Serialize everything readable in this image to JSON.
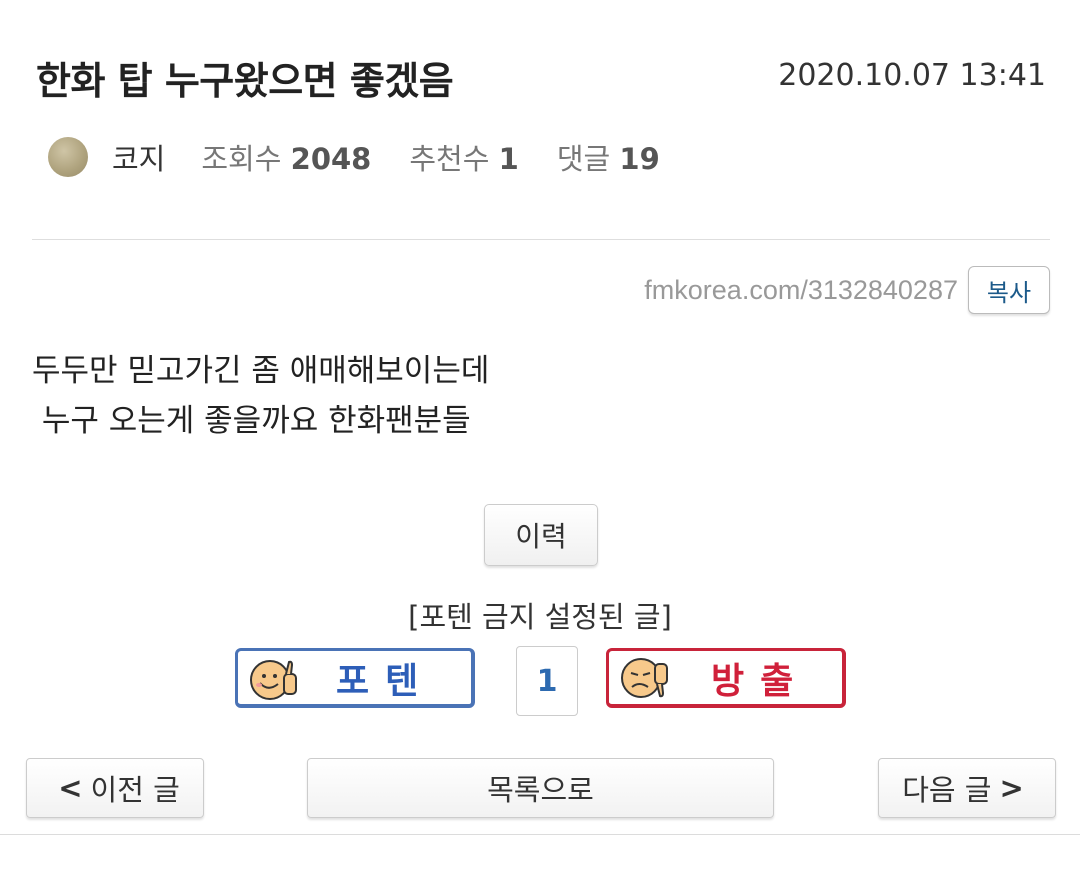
{
  "post": {
    "title": "한화 탑 누구왔으면 좋겠음",
    "date": "2020.10.07 13:41",
    "author": "코지",
    "views_label": "조회수",
    "views": "2048",
    "recommends_label": "추천수",
    "recommends": "1",
    "comments_label": "댓글",
    "comments": "19",
    "url": "fmkorea.com/3132840287",
    "copy_label": "복사",
    "content": [
      "두두만 믿고가긴 좀 애매해보이는데",
      " 누구 오는게 좋을까요 한화팬분들"
    ]
  },
  "actions": {
    "history_label": "이력",
    "restriction_note": "[포텐 금지 설정된 글]",
    "upvote_label": "포텐",
    "vote_count": "1",
    "downvote_label": "방출"
  },
  "nav": {
    "prev_arrow": "<",
    "prev_label": "이전 글",
    "list_label": "목록으로",
    "next_label": "다음 글",
    "next_arrow": ">"
  },
  "colors": {
    "upvote_border": "#4a73b6",
    "upvote_text": "#2d5eb8",
    "downvote_border": "#c8243a",
    "downvote_text": "#d0203a",
    "vote_count": "#2d6ab0"
  },
  "icons": {
    "avatar": "user-avatar",
    "upvote": "smiley-thumbs-up-icon",
    "downvote": "smiley-thumbs-down-icon"
  }
}
